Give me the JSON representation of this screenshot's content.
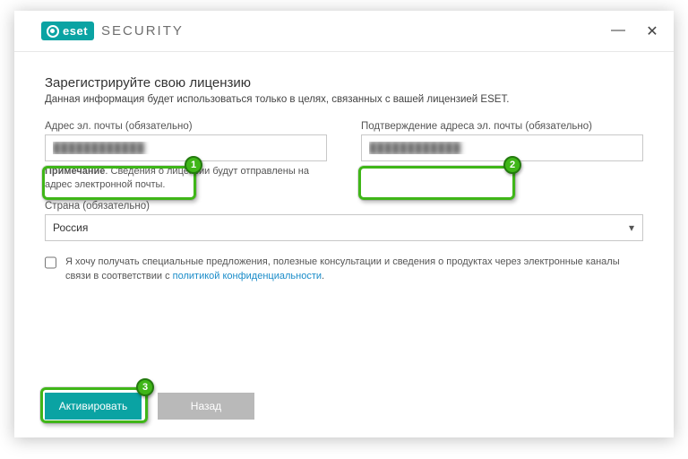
{
  "brand": {
    "logo_text": "eset",
    "product": "SECURITY"
  },
  "window_controls": {
    "minimize": "—",
    "close": "✕"
  },
  "heading": "Зарегистрируйте свою лицензию",
  "subheading": "Данная информация будет использоваться только в целях, связанных с вашей лицензией ESET.",
  "fields": {
    "email": {
      "label": "Адрес эл. почты (обязательно)",
      "value": "████████████"
    },
    "email_confirm": {
      "label": "Подтверждение адреса эл. почты (обязательно)",
      "value": "████████████"
    },
    "note_prefix": "Примечание",
    "note_text": ". Сведения о лицензии будут отправлены на адрес электронной почты.",
    "country": {
      "label": "Страна (обязательно)",
      "value": "Россия"
    }
  },
  "consent": {
    "text_before": "Я хочу получать специальные предложения, полезные консультации и сведения о продуктах через электронные каналы связи в соответствии с ",
    "link_text": "политикой конфиденциальности",
    "text_after": "."
  },
  "buttons": {
    "activate": "Активировать",
    "back": "Назад"
  },
  "annotations": {
    "b1": "1",
    "b2": "2",
    "b3": "3"
  }
}
